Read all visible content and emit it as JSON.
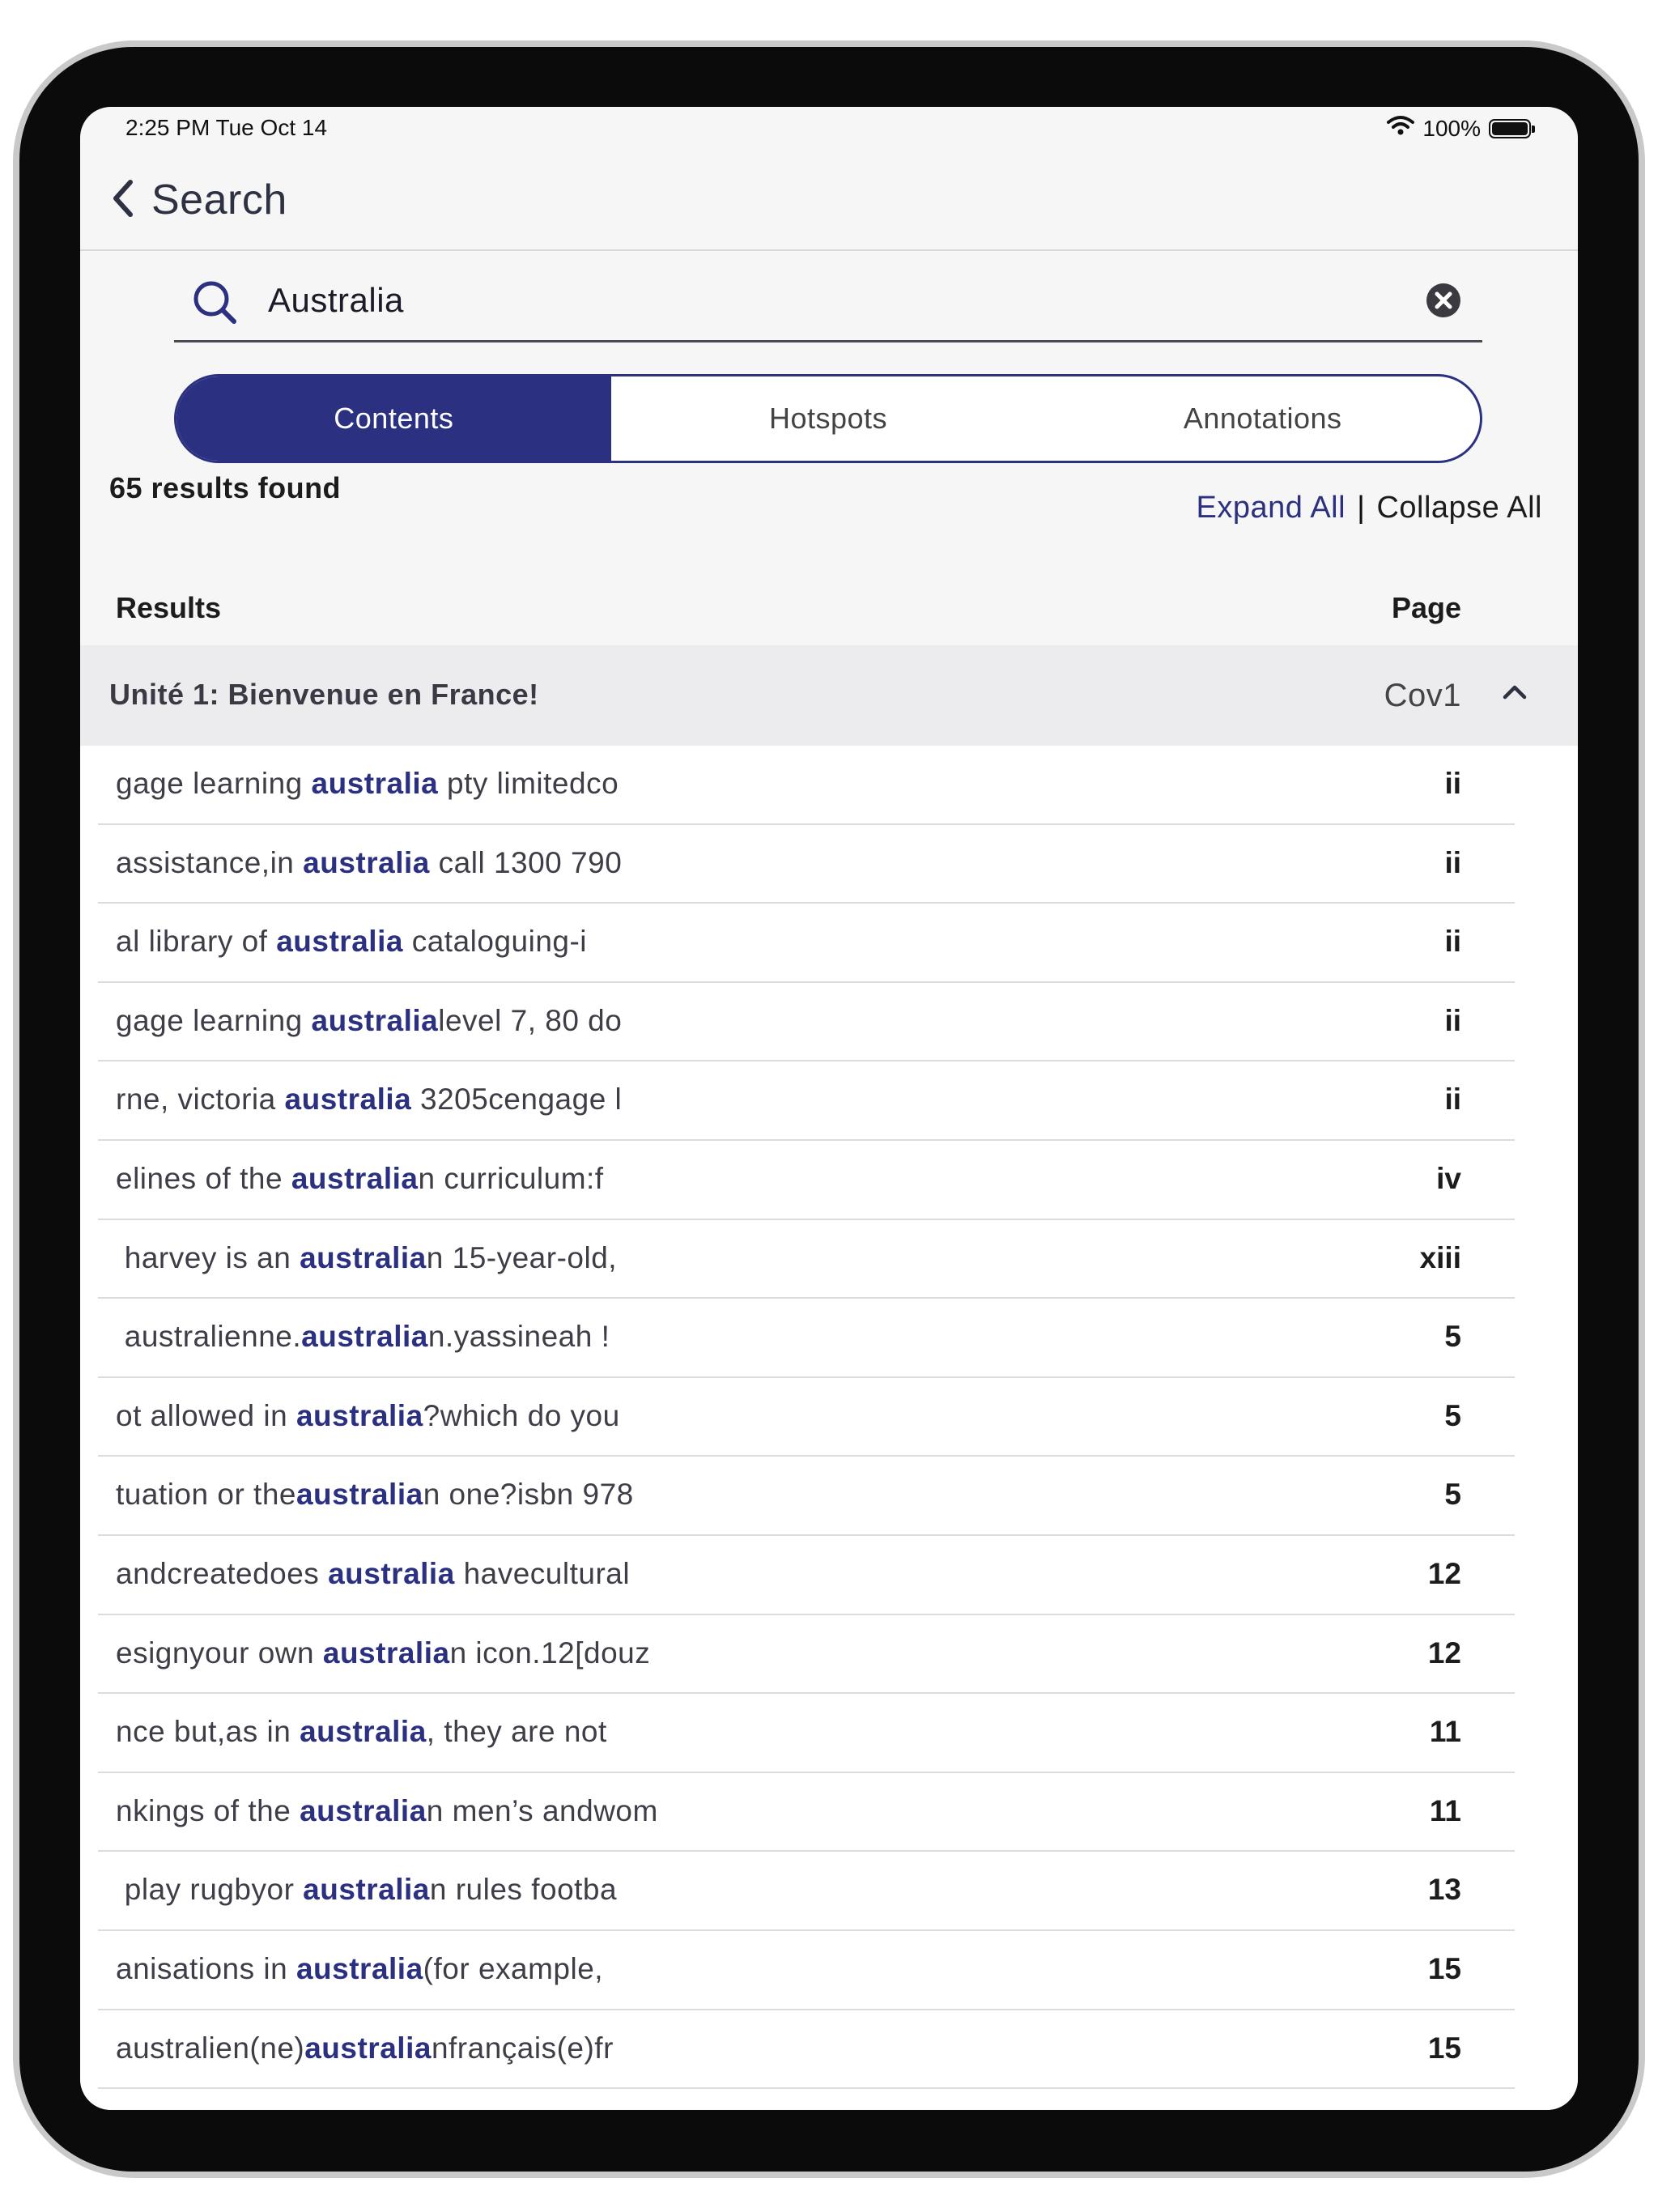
{
  "status_bar": {
    "time": "2:25 PM  Tue Oct 14",
    "battery": "100%"
  },
  "header": {
    "title": "Search"
  },
  "search": {
    "value": "Australia"
  },
  "tabs": [
    {
      "label": "Contents",
      "active": true
    },
    {
      "label": "Hotspots",
      "active": false
    },
    {
      "label": "Annotations",
      "active": false
    }
  ],
  "results_count": "65 results found",
  "controls": {
    "expand_all": "Expand All",
    "separator": "|",
    "collapse_all": "Collapse All"
  },
  "columns": {
    "results": "Results",
    "page": "Page"
  },
  "section": {
    "title": "Unité 1: Bienvenue en France!",
    "page": "Cov1"
  },
  "results": [
    {
      "before": "gage learning ",
      "match": "australia",
      "after": " pty limitedco",
      "page": "ii"
    },
    {
      "before": "assistance,in ",
      "match": "australia",
      "after": " call 1300 790",
      "page": "ii"
    },
    {
      "before": "al library of ",
      "match": "australia",
      "after": " cataloguing-i",
      "page": "ii"
    },
    {
      "before": "gage learning ",
      "match": "australia",
      "after": "level 7, 80 do",
      "page": "ii"
    },
    {
      "before": "rne, victoria ",
      "match": "australia",
      "after": " 3205cengage l",
      "page": "ii"
    },
    {
      "before": "elines of the ",
      "match": "australia",
      "after": "n curriculum:f",
      "page": "iv"
    },
    {
      "before": " harvey is an ",
      "match": "australia",
      "after": "n 15-year-old,",
      "page": "xiii"
    },
    {
      "before": " australienne.",
      "match": "australia",
      "after": "n.yassineah !",
      "page": "5"
    },
    {
      "before": "ot allowed in ",
      "match": "australia",
      "after": "?which do you",
      "page": "5"
    },
    {
      "before": "tuation or the",
      "match": "australia",
      "after": "n one?isbn 978",
      "page": "5"
    },
    {
      "before": "andcreatedoes ",
      "match": "australia",
      "after": " havecultural",
      "page": "12"
    },
    {
      "before": "esignyour own ",
      "match": "australia",
      "after": "n icon.12[douz",
      "page": "12"
    },
    {
      "before": "nce but,as in ",
      "match": "australia",
      "after": ", they are not",
      "page": "11"
    },
    {
      "before": "nkings of the ",
      "match": "australia",
      "after": "n men’s andwom",
      "page": "11"
    },
    {
      "before": " play rugbyor ",
      "match": "australia",
      "after": "n rules footba",
      "page": "13"
    },
    {
      "before": "anisations in ",
      "match": "australia",
      "after": "(for example,",
      "page": "15"
    },
    {
      "before": "australien(ne)",
      "match": "australia",
      "after": "nfrançais(e)fr",
      "page": "15"
    }
  ]
}
